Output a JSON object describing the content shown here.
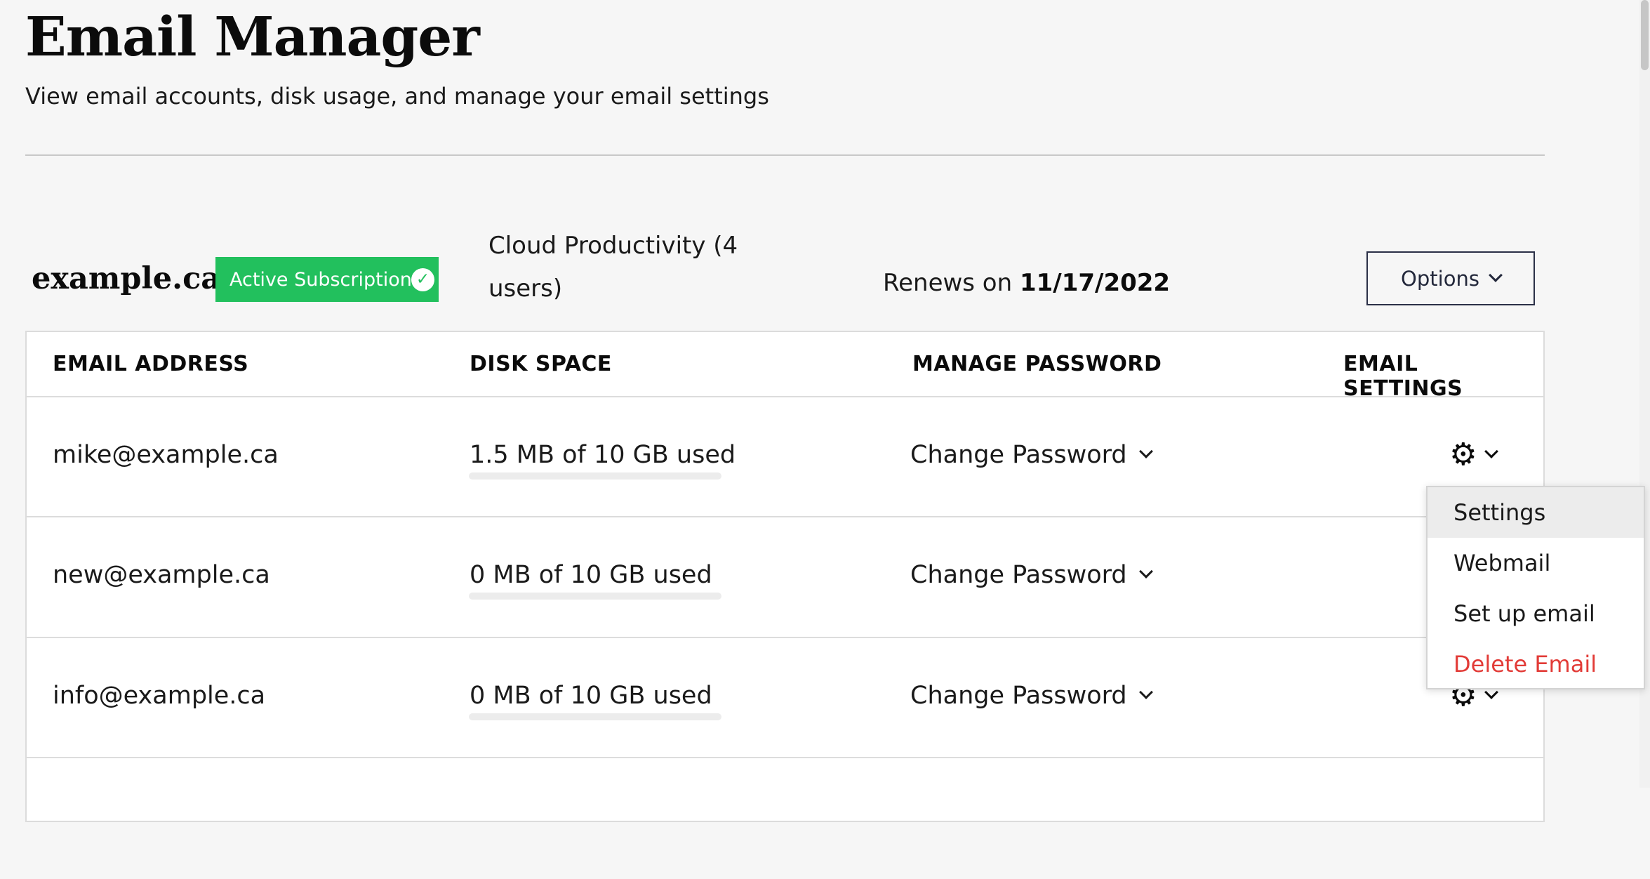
{
  "header": {
    "title": "Email Manager",
    "subtitle": "View email accounts, disk usage, and manage your email settings"
  },
  "domain": {
    "name": "example.ca",
    "subscription_badge": "Active Subscription",
    "plan": "Cloud Productivity (4 users)",
    "renews_label": "Renews on",
    "renews_date": "11/17/2022",
    "options_label": "Options"
  },
  "table": {
    "columns": [
      "EMAIL ADDRESS",
      "DISK SPACE",
      "MANAGE PASSWORD",
      "EMAIL SETTINGS"
    ],
    "rows": [
      {
        "email": "mike@example.ca",
        "disk": "1.5 MB of 10 GB used",
        "disk_fraction": 0.00015,
        "password_action": "Change Password"
      },
      {
        "email": "new@example.ca",
        "disk": "0 MB of 10 GB used",
        "disk_fraction": 0,
        "password_action": "Change Password"
      },
      {
        "email": "info@example.ca",
        "disk": "0 MB of 10 GB used",
        "disk_fraction": 0,
        "password_action": "Change Password"
      }
    ]
  },
  "settings_menu": {
    "items": [
      "Settings",
      "Webmail",
      "Set up email",
      "Delete Email"
    ]
  },
  "icons": {
    "badge": "check-circle-icon",
    "settings": "gear-icon",
    "dropdown": "chevron-down-icon"
  },
  "colors": {
    "accent_green": "#22c05d",
    "danger_red": "#e23b37",
    "options_border": "#2b3047"
  }
}
